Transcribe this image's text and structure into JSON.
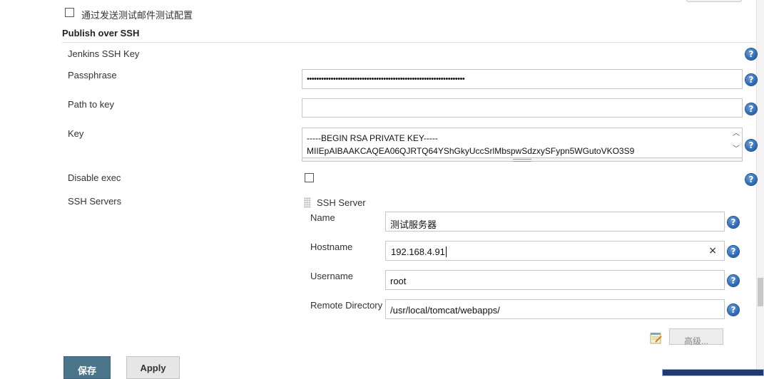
{
  "email_test": {
    "label": "通过发送测试邮件测试配置"
  },
  "section": {
    "title": "Publish over SSH"
  },
  "rows": {
    "jenkins_key": {
      "label": "Jenkins SSH Key"
    },
    "passphrase": {
      "label": "Passphrase",
      "value": "••••••••••••••••••••••••••••••••••••••••••••••••••••••••••••••••••"
    },
    "path_to_key": {
      "label": "Path to key",
      "value": ""
    },
    "key": {
      "label": "Key",
      "line1": "-----BEGIN RSA PRIVATE KEY-----",
      "line2": "MIIEpAIBAAKCAQEA06QJRTQ64YShGkyUccSrlMbspwSdzxySFypn5WGutoVKO3S9"
    },
    "disable_exec": {
      "label": "Disable exec"
    },
    "ssh_servers": {
      "label": "SSH Servers"
    }
  },
  "ssh_server": {
    "header": "SSH Server",
    "name": {
      "label": "Name",
      "value": "测试服务器"
    },
    "hostname": {
      "label": "Hostname",
      "value": "192.168.4.91",
      "clear": "×"
    },
    "username": {
      "label": "Username",
      "value": "root"
    },
    "remote_dir": {
      "label": "Remote Directory",
      "value": "/usr/local/tomcat/webapps/"
    },
    "advanced_label": "高级..."
  },
  "help_glyph": "?",
  "buttons": {
    "save": "保存",
    "apply": "Apply"
  },
  "colors": {
    "help": "#2f6cb5",
    "save_bg": "#4b758b",
    "apply_bg": "#e6e6e6"
  }
}
